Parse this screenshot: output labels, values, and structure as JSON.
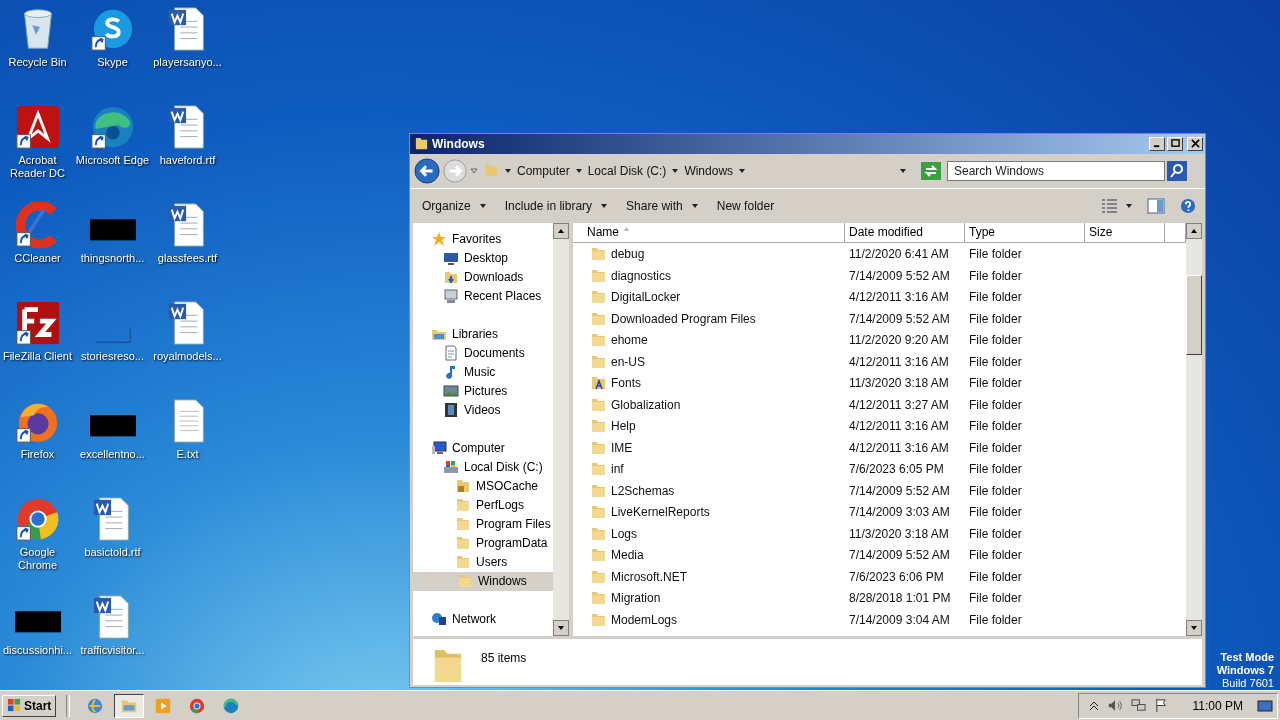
{
  "desktop": {
    "icons": [
      {
        "label": "Recycle Bin",
        "kind": "recycle",
        "shortcut": false
      },
      {
        "label": "Acrobat Reader DC",
        "kind": "acrobat",
        "shortcut": true
      },
      {
        "label": "CCleaner",
        "kind": "ccleaner",
        "shortcut": true
      },
      {
        "label": "FileZilla Client",
        "kind": "filezilla",
        "shortcut": true
      },
      {
        "label": "Firefox",
        "kind": "firefox",
        "shortcut": true
      },
      {
        "label": "Google Chrome",
        "kind": "chrome",
        "shortcut": true
      },
      {
        "label": "discussionhi...",
        "kind": "redacted",
        "shortcut": false
      },
      {
        "label": "Skype",
        "kind": "skype",
        "shortcut": true
      },
      {
        "label": "Microsoft Edge",
        "kind": "edge",
        "shortcut": true
      },
      {
        "label": "thingsnorth...",
        "kind": "redacted",
        "shortcut": false
      },
      {
        "label": "storiesreso...",
        "kind": "blank",
        "shortcut": false
      },
      {
        "label": "excellentno...",
        "kind": "redacted",
        "shortcut": false
      },
      {
        "label": "basictold.rtf",
        "kind": "word",
        "shortcut": false
      },
      {
        "label": "trafficvisitor...",
        "kind": "word",
        "shortcut": false
      },
      {
        "label": "playersanyo...",
        "kind": "word",
        "shortcut": false
      },
      {
        "label": "haveford.rtf",
        "kind": "word",
        "shortcut": false
      },
      {
        "label": "glassfees.rtf",
        "kind": "word",
        "shortcut": false
      },
      {
        "label": "royalmodels...",
        "kind": "word",
        "shortcut": false
      },
      {
        "label": "E.txt",
        "kind": "text",
        "shortcut": false
      }
    ],
    "watermark_text": [
      "Test Mode",
      "Windows 7",
      "Build 7601"
    ]
  },
  "window": {
    "title": "Windows",
    "address": [
      "Computer",
      "Local Disk (C:)",
      "Windows"
    ],
    "search": {
      "placeholder": "Search Windows"
    },
    "toolbar": [
      {
        "label": "Organize",
        "dropdown": true
      },
      {
        "label": "Include in library",
        "dropdown": true
      },
      {
        "label": "Share with",
        "dropdown": true
      },
      {
        "label": "New folder",
        "dropdown": false
      }
    ],
    "nav": [
      {
        "label": "Favorites",
        "kind": "star",
        "selected": false,
        "children": [
          {
            "label": "Desktop",
            "kind": "desktop",
            "selected": false
          },
          {
            "label": "Downloads",
            "kind": "downloads",
            "selected": false
          },
          {
            "label": "Recent Places",
            "kind": "recent",
            "selected": false
          }
        ]
      },
      {
        "label": "Libraries",
        "kind": "libraries",
        "selected": false,
        "children": [
          {
            "label": "Documents",
            "kind": "documents",
            "selected": false
          },
          {
            "label": "Music",
            "kind": "music",
            "selected": false
          },
          {
            "label": "Pictures",
            "kind": "pictures",
            "selected": false
          },
          {
            "label": "Videos",
            "kind": "videos",
            "selected": false
          }
        ]
      },
      {
        "label": "Computer",
        "kind": "computer",
        "selected": false,
        "children": [
          {
            "label": "Local Disk (C:)",
            "kind": "disk",
            "selected": false,
            "children": [
              {
                "label": "MSOCache",
                "kind": "locked",
                "selected": false
              },
              {
                "label": "PerfLogs",
                "kind": "folder",
                "selected": false
              },
              {
                "label": "Program Files",
                "kind": "folder",
                "selected": false
              },
              {
                "label": "ProgramData",
                "kind": "folder",
                "selected": false
              },
              {
                "label": "Users",
                "kind": "folder",
                "selected": false
              },
              {
                "label": "Windows",
                "kind": "folder",
                "selected": true
              }
            ]
          }
        ]
      },
      {
        "label": "Network",
        "kind": "network",
        "selected": false
      }
    ],
    "columns": [
      "Name",
      "Date modified",
      "Type",
      "Size"
    ],
    "rows": [
      {
        "name": "debug",
        "date": "11/2/2020 6:41 AM",
        "type": "File folder",
        "kind": "folder"
      },
      {
        "name": "diagnostics",
        "date": "7/14/2009 5:52 AM",
        "type": "File folder",
        "kind": "folder"
      },
      {
        "name": "DigitalLocker",
        "date": "4/12/2011 3:16 AM",
        "type": "File folder",
        "kind": "folder"
      },
      {
        "name": "Downloaded Program Files",
        "date": "7/14/2009 5:52 AM",
        "type": "File folder",
        "kind": "folder"
      },
      {
        "name": "ehome",
        "date": "11/2/2020 9:20 AM",
        "type": "File folder",
        "kind": "folder"
      },
      {
        "name": "en-US",
        "date": "4/12/2011 3:16 AM",
        "type": "File folder",
        "kind": "folder"
      },
      {
        "name": "Fonts",
        "date": "11/3/2020 3:18 AM",
        "type": "File folder",
        "kind": "fonts"
      },
      {
        "name": "Globalization",
        "date": "4/12/2011 3:27 AM",
        "type": "File folder",
        "kind": "folder"
      },
      {
        "name": "Help",
        "date": "4/12/2011 3:16 AM",
        "type": "File folder",
        "kind": "folder"
      },
      {
        "name": "IME",
        "date": "4/12/2011 3:16 AM",
        "type": "File folder",
        "kind": "folder"
      },
      {
        "name": "inf",
        "date": "7/6/2023 6:05 PM",
        "type": "File folder",
        "kind": "folder"
      },
      {
        "name": "L2Schemas",
        "date": "7/14/2009 5:52 AM",
        "type": "File folder",
        "kind": "folder"
      },
      {
        "name": "LiveKernelReports",
        "date": "7/14/2009 3:03 AM",
        "type": "File folder",
        "kind": "folder"
      },
      {
        "name": "Logs",
        "date": "11/3/2020 3:18 AM",
        "type": "File folder",
        "kind": "folder"
      },
      {
        "name": "Media",
        "date": "7/14/2009 5:52 AM",
        "type": "File folder",
        "kind": "folder"
      },
      {
        "name": "Microsoft.NET",
        "date": "7/6/2023 6:06 PM",
        "type": "File folder",
        "kind": "folder"
      },
      {
        "name": "Migration",
        "date": "8/28/2018 1:01 PM",
        "type": "File folder",
        "kind": "folder"
      },
      {
        "name": "ModemLogs",
        "date": "7/14/2009 3:04 AM",
        "type": "File folder",
        "kind": "folder"
      }
    ],
    "status": "85 items"
  },
  "taskbar": {
    "start": "Start",
    "apps": [
      {
        "kind": "ie",
        "selected": false
      },
      {
        "kind": "explorer",
        "selected": true
      },
      {
        "kind": "media",
        "selected": false
      },
      {
        "kind": "chrome",
        "selected": false
      },
      {
        "kind": "edge",
        "selected": false
      }
    ],
    "clock": "11:00 PM"
  }
}
